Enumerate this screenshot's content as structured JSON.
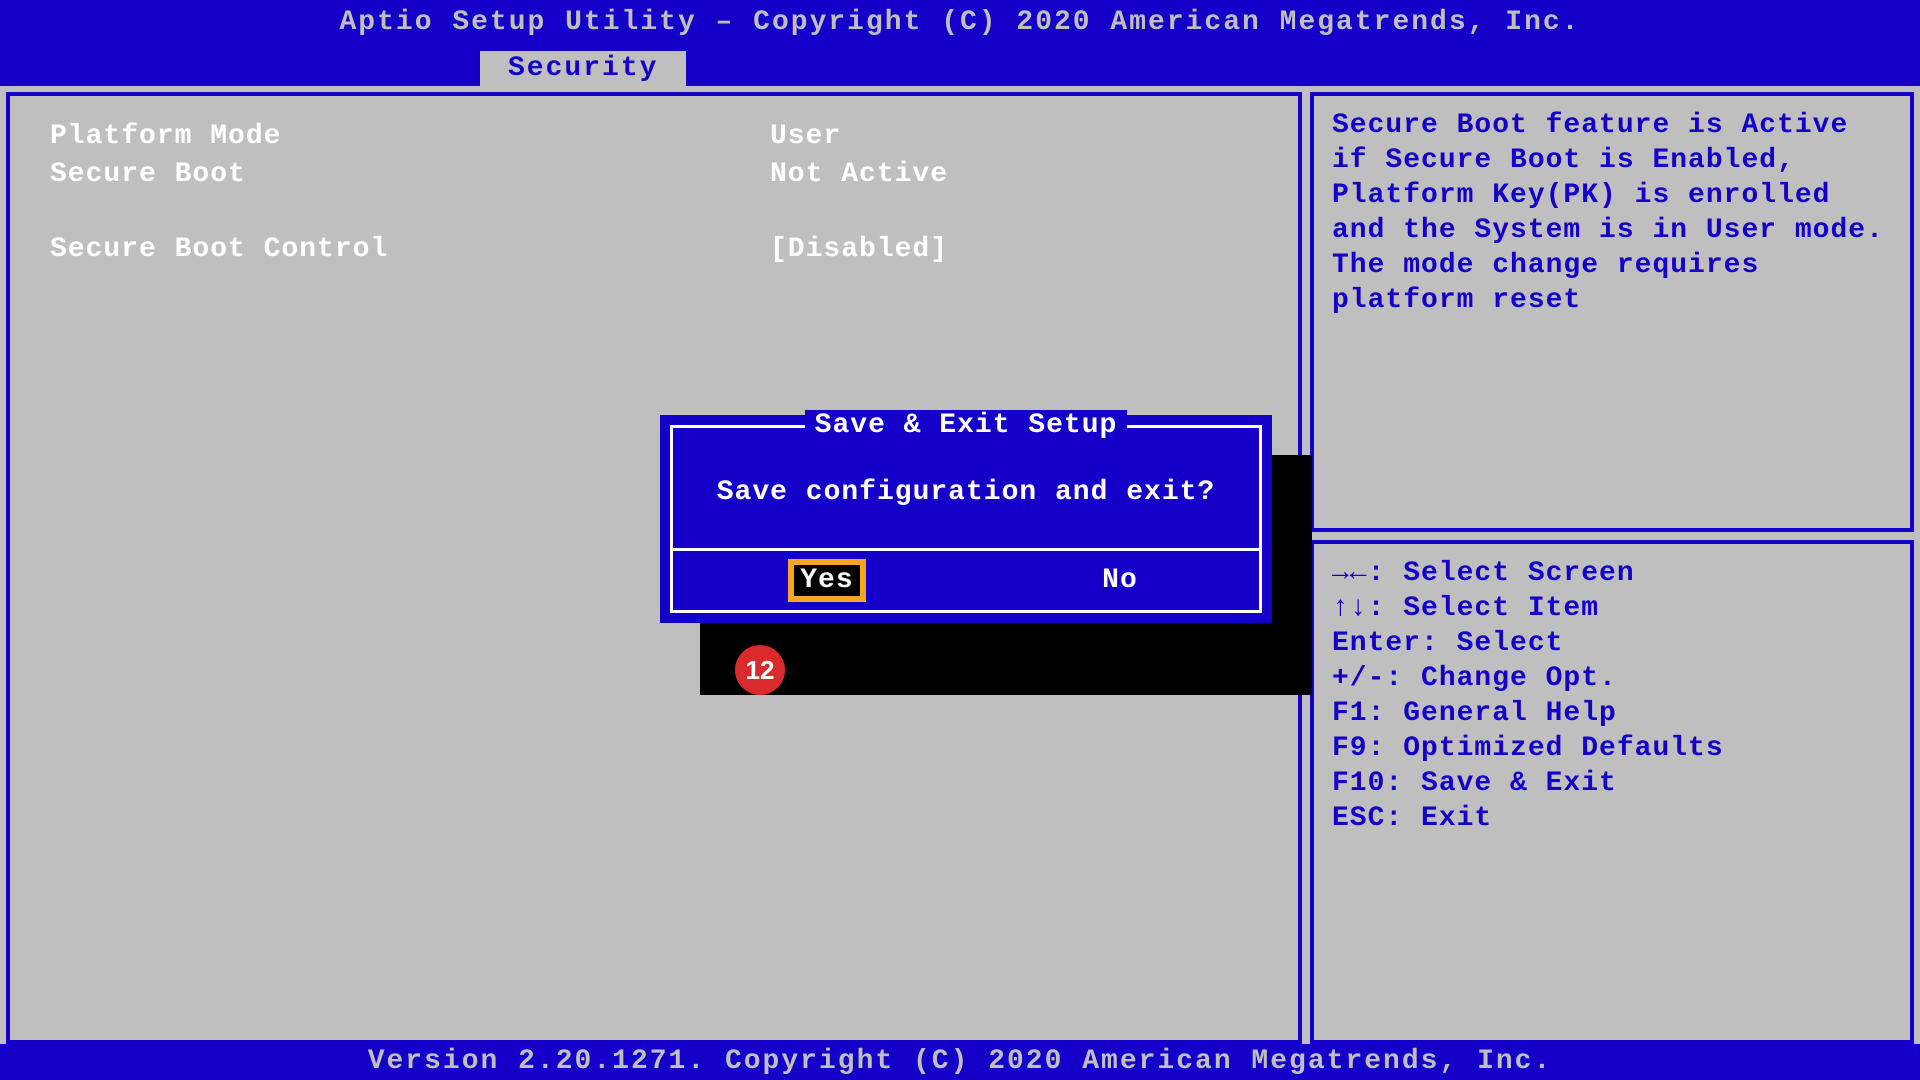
{
  "titlebar": "Aptio Setup Utility – Copyright (C) 2020 American Megatrends, Inc.",
  "tab": "Security",
  "settings": [
    {
      "label": "Platform Mode",
      "value": "User"
    },
    {
      "label": "Secure Boot",
      "value": "Not Active"
    },
    {
      "label": "",
      "value": ""
    },
    {
      "label": "Secure Boot Control",
      "value": "[Disabled]"
    }
  ],
  "help_text": "Secure Boot feature is Active if Secure Boot is Enabled, Platform Key(PK) is enrolled and the System is in User mode. The mode change requires platform reset",
  "key_hints": [
    "→←: Select Screen",
    "↑↓: Select Item",
    "Enter: Select",
    "+/-: Change Opt.",
    "F1: General Help",
    "F9: Optimized Defaults",
    "F10: Save & Exit",
    "ESC: Exit"
  ],
  "dialog": {
    "title": "Save & Exit Setup",
    "message": "Save configuration and exit?",
    "yes": "Yes",
    "no": "No"
  },
  "annotation": "12",
  "footer": "Version 2.20.1271. Copyright (C) 2020 American Megatrends, Inc."
}
